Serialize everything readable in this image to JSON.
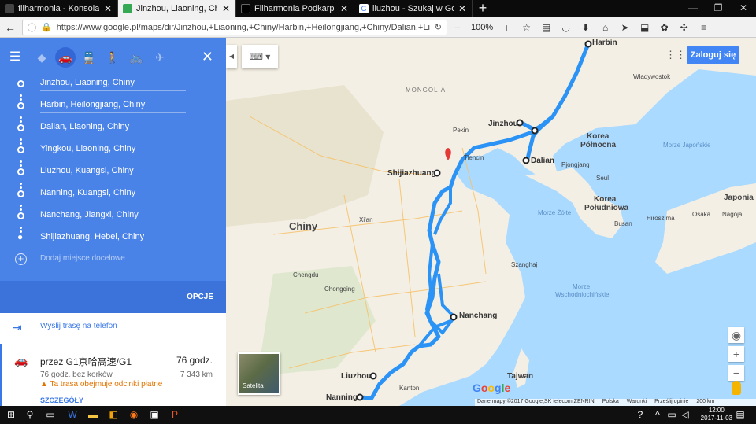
{
  "browser": {
    "tabs": [
      {
        "title": "filharmonia - Konsola admin",
        "icon": "admin-icon",
        "color": "#2a2a2a"
      },
      {
        "title": "Jinzhou, Liaoning, Chiny do",
        "icon": "google-maps-icon",
        "color": "#4285f4"
      },
      {
        "title": "Filharmonia Podkarpacka",
        "icon": "black-square-icon",
        "color": "#000000"
      },
      {
        "title": "liuzhou - Szukaj w Google",
        "icon": "google-g-icon",
        "color": "#ffffff"
      }
    ],
    "url": "https://www.google.pl/maps/dir/Jinzhou,+Liaoning,+Chiny/Harbin,+Heilongjiang,+Chiny/Dalian,+Liaoning,+Chiny/",
    "zoom": "100%"
  },
  "directions": {
    "stops": [
      "Jinzhou, Liaoning, Chiny",
      "Harbin, Heilongjiang, Chiny",
      "Dalian, Liaoning, Chiny",
      "Yingkou, Liaoning, Chiny",
      "Liuzhou, Kuangsi, Chiny",
      "Nanning, Kuangsi, Chiny",
      "Nanchang, Jiangxi, Chiny",
      "Shijiazhuang, Hebei, Chiny"
    ],
    "add_destination": "Dodaj miejsce docelowe",
    "options": "OPCJE",
    "send_to_phone": "Wyślij trasę na telefon",
    "route": {
      "via": "przez G1京哈高速/G1",
      "duration": "76 godz.",
      "without_traffic": "76 godz. bez korków",
      "distance": "7 343 km",
      "warning": "Ta trasa obejmuje odcinki płatne",
      "details": "SZCZEGÓŁY"
    }
  },
  "map": {
    "login_button": "Zaloguj się",
    "satellite_label": "Satelita",
    "labels": {
      "harbin": "Harbin",
      "jinzhou": "Jinzhou",
      "dalian": "Dalian",
      "shijiazhuang": "Shijiazhuang",
      "nanchang": "Nanchang",
      "liuzhou": "Liuzhou",
      "nanning": "Nanning",
      "chiny": "Chiny",
      "korea_n1": "Korea",
      "korea_n2": "Północna",
      "korea_s1": "Korea",
      "korea_s2": "Południowa",
      "japonia": "Japonia",
      "tajwan": "Tajwan",
      "morze_zolte": "Morze Żółte",
      "morze_japonskie": "Morze Japońskie",
      "morze_wsch": "Morze",
      "morze_wsch2": "Wschodniochińskie",
      "mongolia": "MONGOLIA",
      "pekin": "Pekin",
      "tianjin": "Tiencin",
      "wladywostok": "Władywostok",
      "pyongyang": "Pjongjang",
      "seul": "Seul",
      "shanghai": "Szanghaj",
      "chengdu": "Chengdu",
      "chongqing": "Chongqing",
      "xian": "Xi'an",
      "kanton": "Kanton",
      "busan": "Busan",
      "hiroszima": "Hiroszima",
      "osaka": "Osaka",
      "nagoja": "Nagoja"
    },
    "footer": {
      "data": "Dane mapy ©2017 Google,SK telecom,ZENRIN",
      "country": "Polska",
      "terms": "Warunki",
      "feedback": "Prześlij opinię",
      "scale": "200 km"
    }
  },
  "taskbar": {
    "time": "12:00",
    "date": "2017-11-03"
  }
}
